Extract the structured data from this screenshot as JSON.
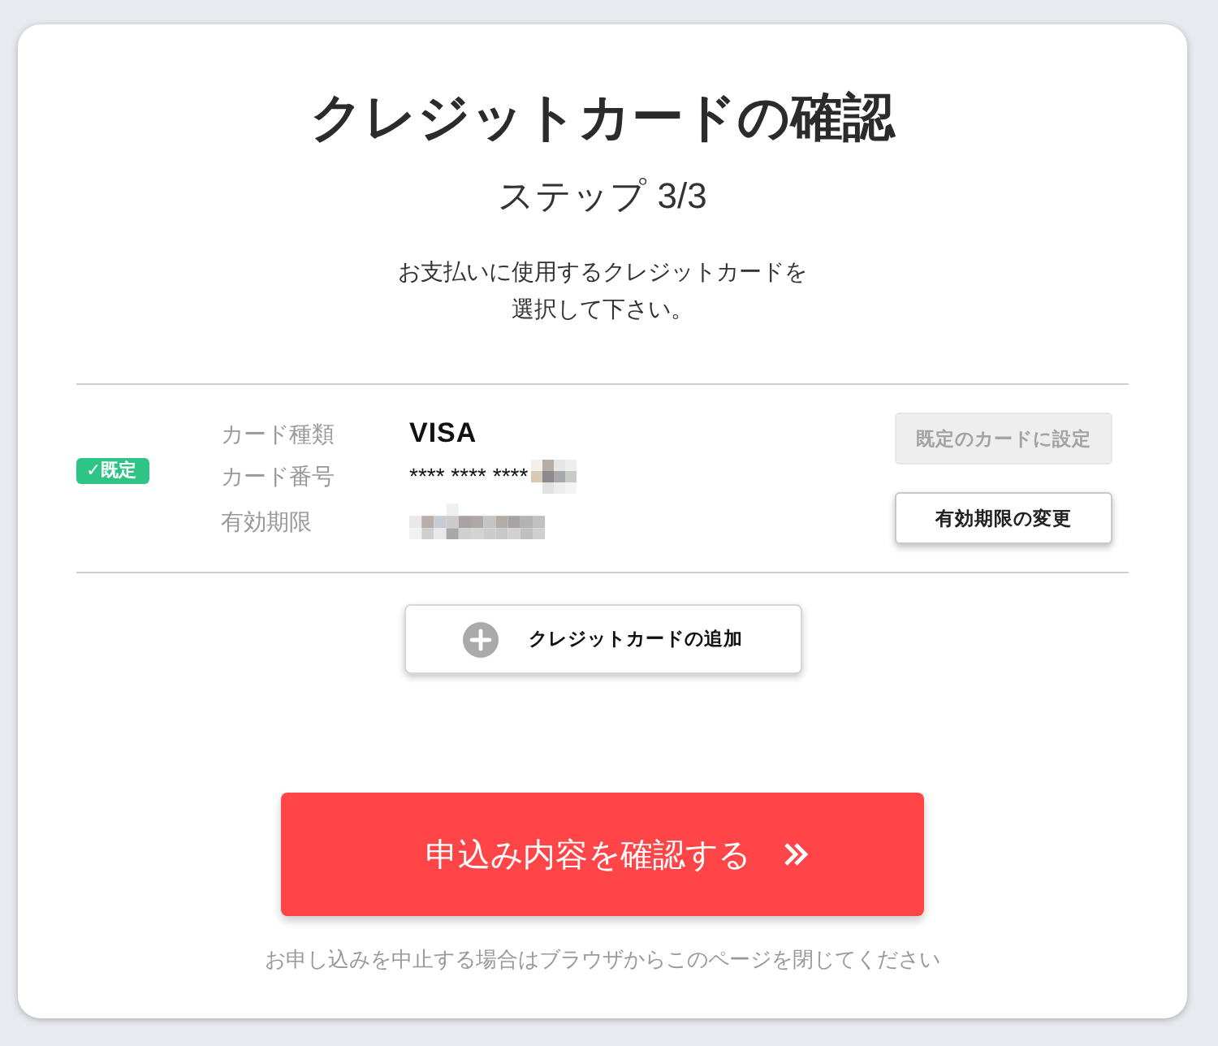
{
  "header": {
    "title": "クレジットカードの確認",
    "step": "ステップ 3/3",
    "instruction": "お支払いに使用するクレジットカードを選択して下さい。"
  },
  "cards": [
    {
      "default": true,
      "badge": "✓既定",
      "fields": [
        {
          "kind": "brand",
          "label": "カード種類",
          "value": "VISA"
        },
        {
          "kind": "masked",
          "label": "カード番号",
          "value": "**** **** ****"
        },
        {
          "kind": "redacted",
          "label": "有効期限"
        }
      ],
      "buttons": [
        {
          "label": "既定のカードに設定",
          "disabled": true
        },
        {
          "label": "有効期限の変更",
          "disabled": false
        }
      ]
    }
  ],
  "add_button": {
    "label": "クレジットカードの追加"
  },
  "submit_button": {
    "label": "申込み内容を確認する"
  },
  "footer_note": "お申し込みを中止する場合はブラウザからこのページを閉じてください"
}
